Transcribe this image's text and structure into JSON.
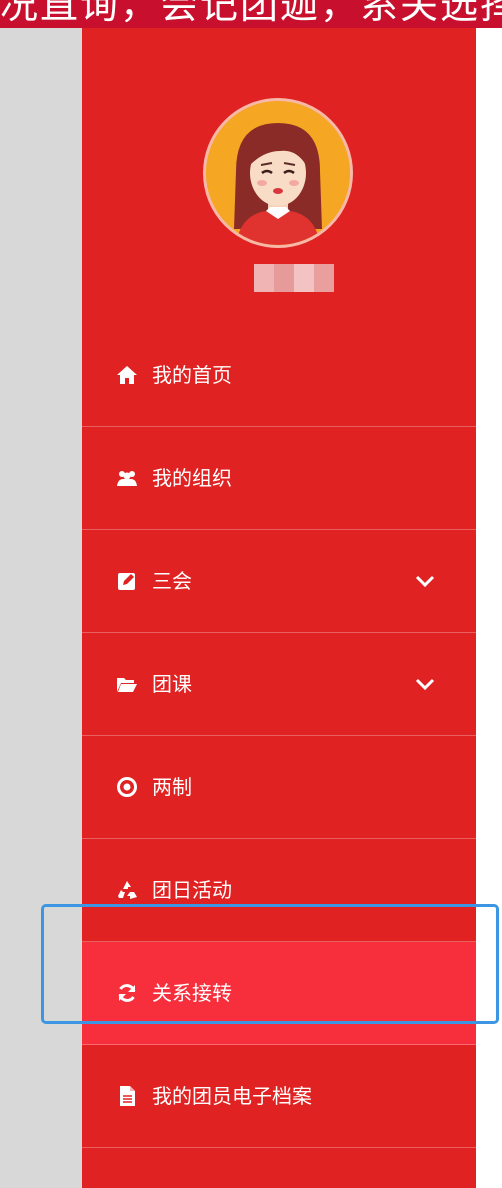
{
  "top_bar": {
    "text": "况直询，会记团迦，系关选择"
  },
  "user": {
    "name": "███"
  },
  "menu": [
    {
      "label": "我的首页",
      "icon": "home-icon",
      "expandable": false,
      "active": false
    },
    {
      "label": "我的组织",
      "icon": "users-icon",
      "expandable": false,
      "active": false
    },
    {
      "label": "三会",
      "icon": "edit-icon",
      "expandable": true,
      "active": false
    },
    {
      "label": "团课",
      "icon": "folder-open-icon",
      "expandable": true,
      "active": false
    },
    {
      "label": "两制",
      "icon": "dot-circle-icon",
      "expandable": false,
      "active": false
    },
    {
      "label": "团日活动",
      "icon": "recycle-icon",
      "expandable": false,
      "active": false
    },
    {
      "label": "关系接转",
      "icon": "refresh-icon",
      "expandable": false,
      "active": true
    },
    {
      "label": "我的团员电子档案",
      "icon": "file-icon",
      "expandable": false,
      "active": false
    }
  ],
  "colors": {
    "sidebar": "#e02222",
    "active_item": "#f72f3c",
    "top_bar": "#c8102e",
    "avatar_bg": "#f5a623",
    "focus_outline": "#3d96e3"
  }
}
